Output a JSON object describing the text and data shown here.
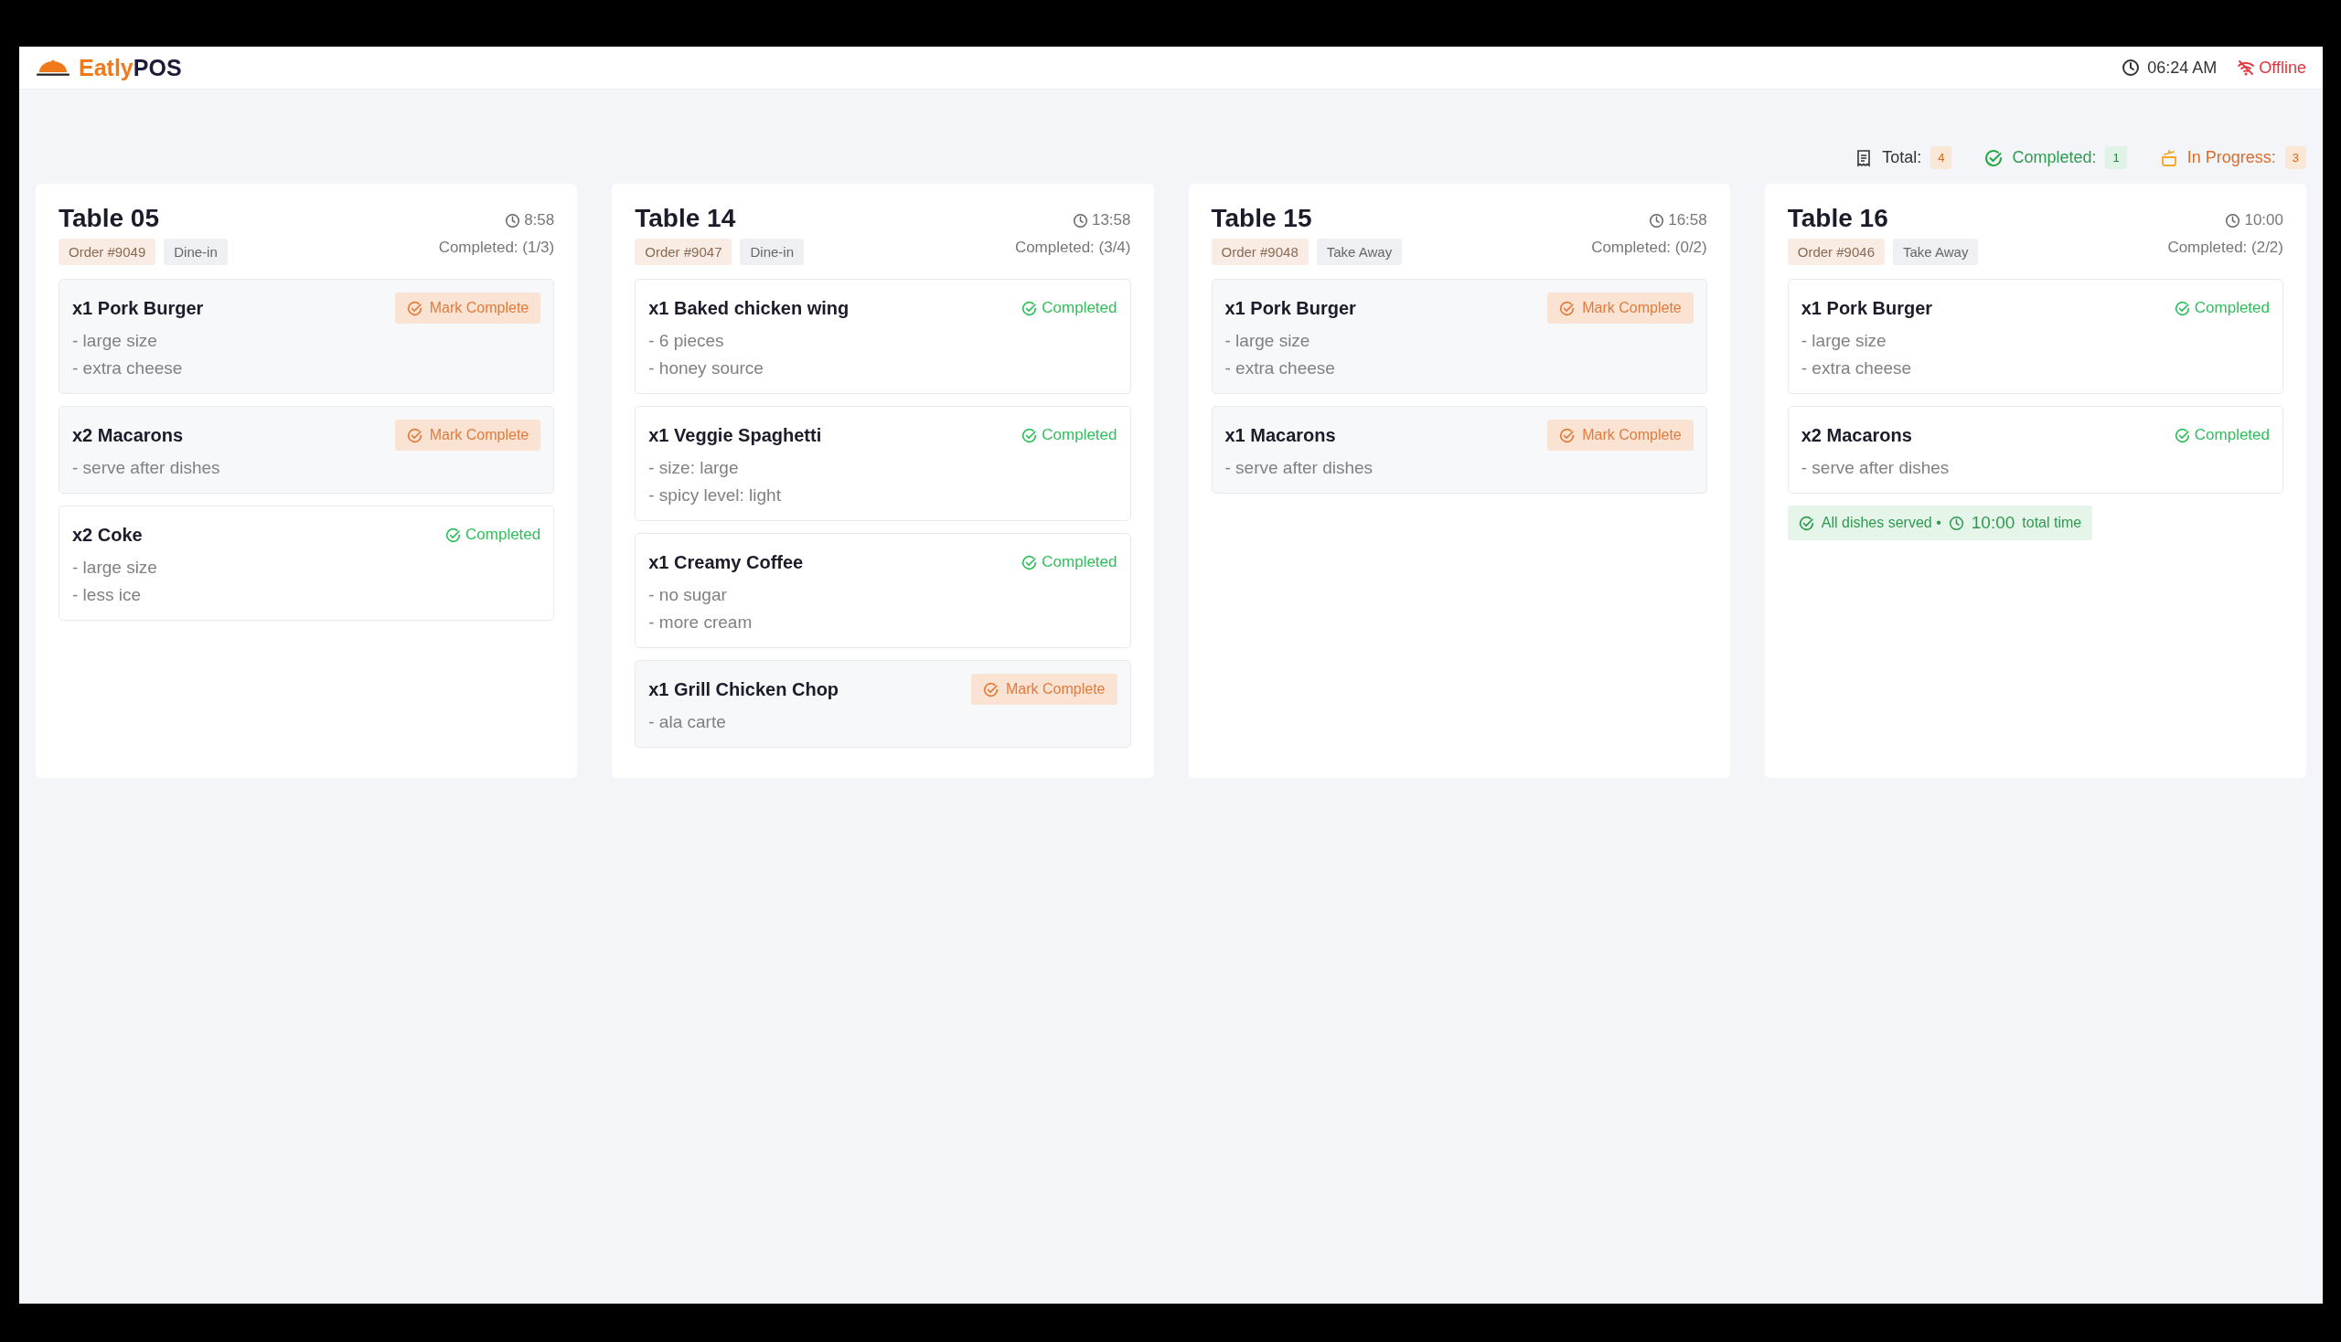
{
  "brand": {
    "primary": "Eatly",
    "secondary": "POS"
  },
  "header": {
    "time": "06:24 AM",
    "connection": {
      "label": "Offline",
      "online": false
    }
  },
  "stats": [
    {
      "kind": "total",
      "label": "Total:",
      "count": "4"
    },
    {
      "kind": "completed",
      "label": "Completed:",
      "count": "1"
    },
    {
      "kind": "in_progress",
      "label": "In Progress:",
      "count": "3"
    }
  ],
  "orders": [
    {
      "table": "Table 05",
      "elapsed": "8:58",
      "order_no": "Order #9049",
      "service": "Dine-in",
      "progress": "Completed: (1/3)",
      "items": [
        {
          "name": "x1 Pork Burger",
          "notes": [
            "- large size",
            "- extra cheese"
          ],
          "completed": false,
          "status_label": "Mark Complete"
        },
        {
          "name": "x2 Macarons",
          "notes": [
            "- serve after dishes"
          ],
          "completed": false,
          "status_label": "Mark Complete"
        },
        {
          "name": "x2 Coke",
          "notes": [
            "- large size",
            "- less ice"
          ],
          "completed": true,
          "status_label": "Completed"
        }
      ]
    },
    {
      "table": "Table 14",
      "elapsed": "13:58",
      "order_no": "Order #9047",
      "service": "Dine-in",
      "progress": "Completed: (3/4)",
      "items": [
        {
          "name": "x1 Baked chicken wing",
          "notes": [
            "- 6 pieces",
            "- honey source"
          ],
          "completed": true,
          "status_label": "Completed"
        },
        {
          "name": "x1 Veggie Spaghetti",
          "notes": [
            "- size: large",
            "- spicy level: light"
          ],
          "completed": true,
          "status_label": "Completed"
        },
        {
          "name": "x1 Creamy Coffee",
          "notes": [
            "- no sugar",
            "- more cream"
          ],
          "completed": true,
          "status_label": "Completed"
        },
        {
          "name": "x1 Grill Chicken Chop",
          "notes": [
            "- ala carte"
          ],
          "completed": false,
          "status_label": "Mark Complete"
        }
      ]
    },
    {
      "table": "Table 15",
      "elapsed": "16:58",
      "order_no": "Order #9048",
      "service": "Take Away",
      "progress": "Completed: (0/2)",
      "items": [
        {
          "name": "x1 Pork Burger",
          "notes": [
            "- large size",
            "- extra cheese"
          ],
          "completed": false,
          "status_label": "Mark Complete"
        },
        {
          "name": "x1 Macarons",
          "notes": [
            "- serve after dishes"
          ],
          "completed": false,
          "status_label": "Mark Complete"
        }
      ]
    },
    {
      "table": "Table 16",
      "elapsed": "10:00",
      "order_no": "Order #9046",
      "service": "Take Away",
      "progress": "Completed: (2/2)",
      "items": [
        {
          "name": "x1 Pork Burger",
          "notes": [
            "- large size",
            "- extra cheese"
          ],
          "completed": true,
          "status_label": "Completed"
        },
        {
          "name": "x2 Macarons",
          "notes": [
            "- serve after dishes"
          ],
          "completed": true,
          "status_label": "Completed"
        }
      ],
      "summary": {
        "text": "All dishes served •",
        "time": "10:00",
        "suffix": "total time"
      }
    }
  ]
}
